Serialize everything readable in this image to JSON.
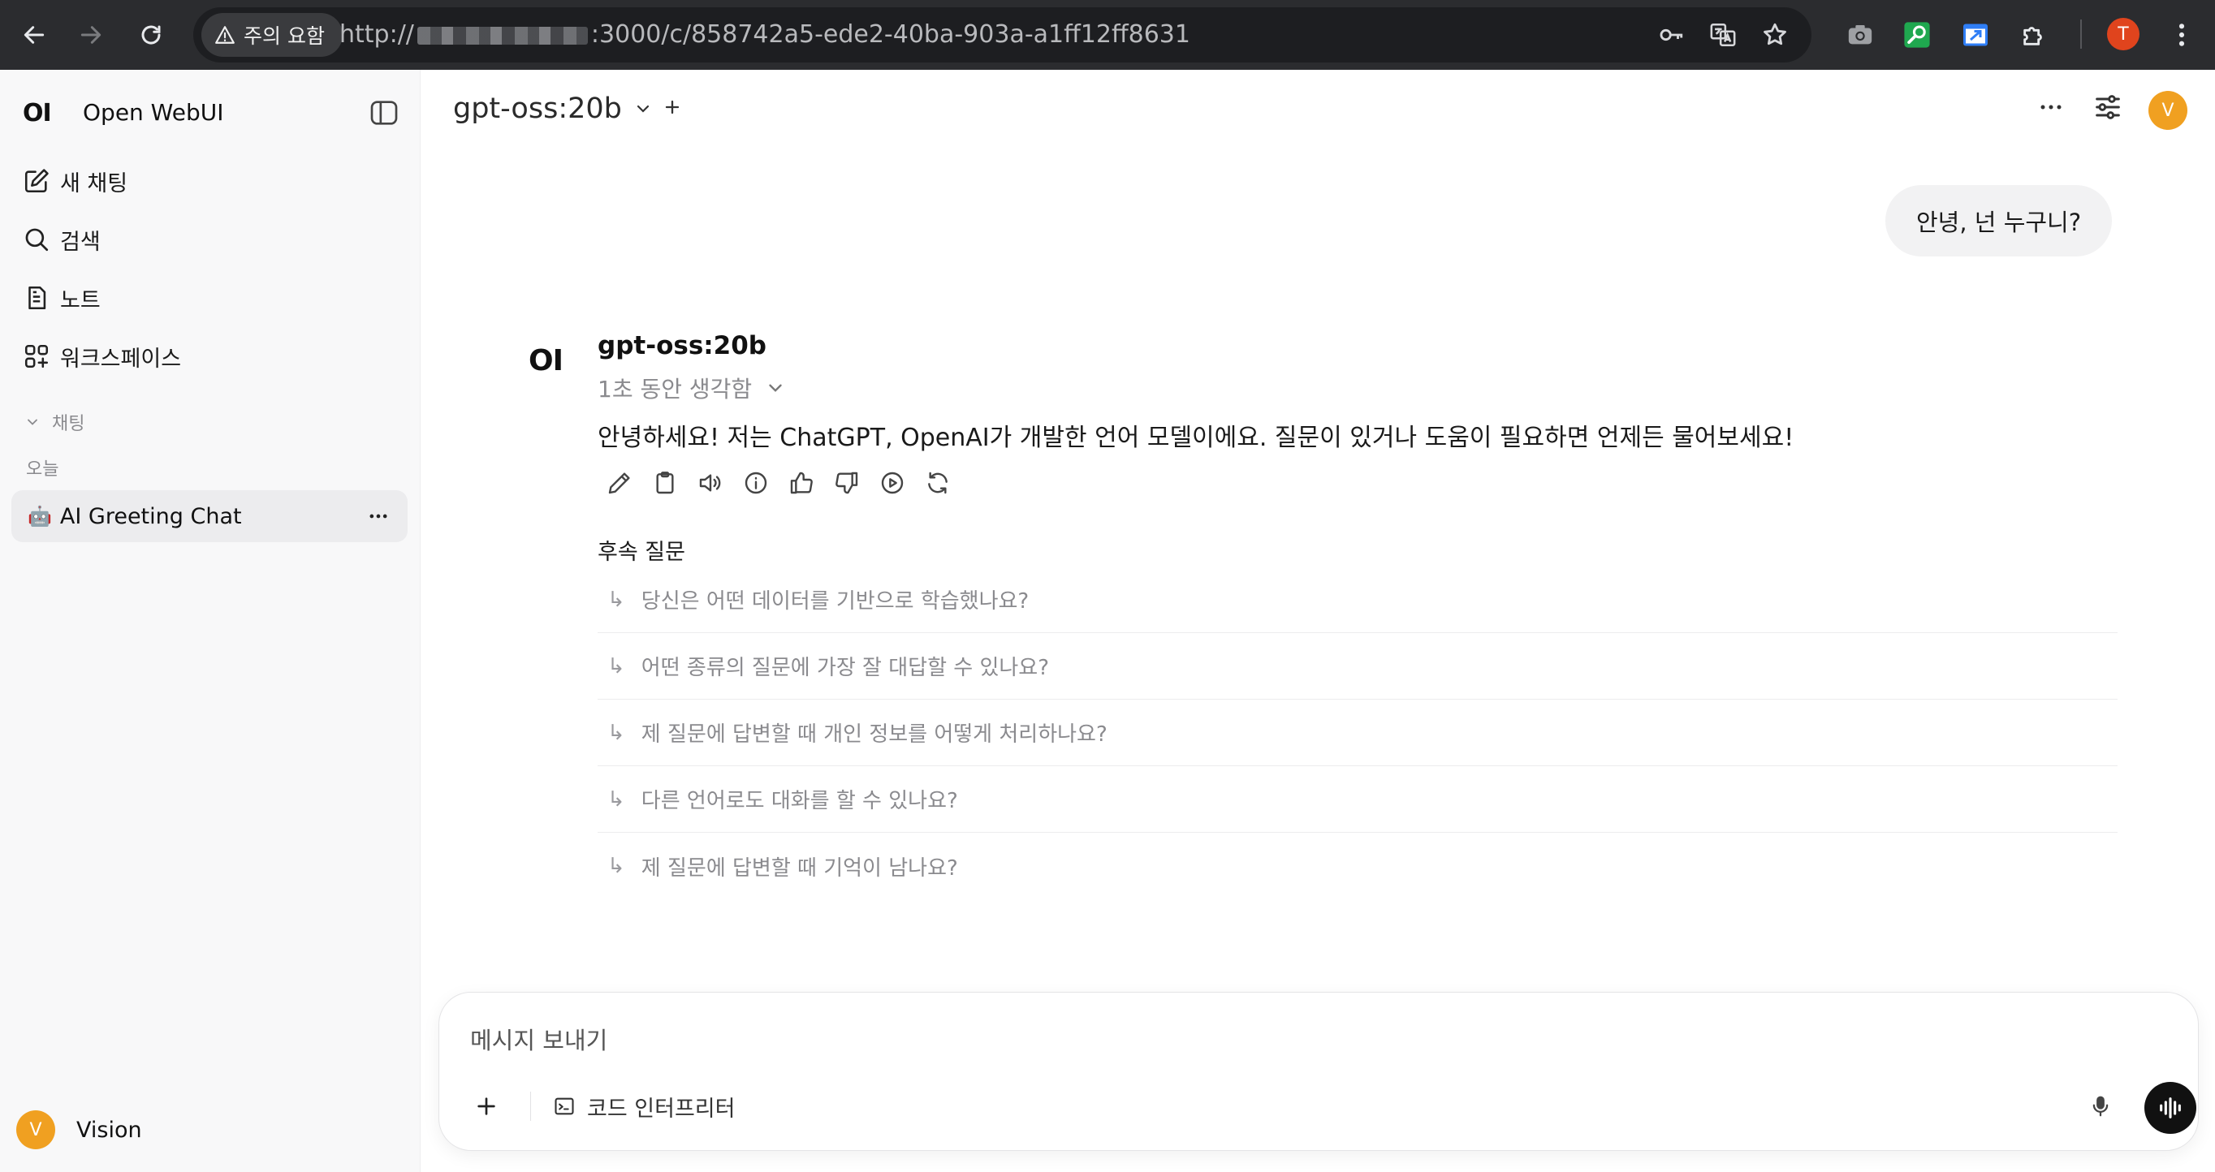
{
  "browser": {
    "security_label": "주의 요함",
    "url_prefix": "http://",
    "url_suffix": ":3000/c/858742a5-ede2-40ba-903a-a1ff12ff8631",
    "profile_initial": "T"
  },
  "sidebar": {
    "logo": "OI",
    "app_name": "Open WebUI",
    "items": [
      {
        "label": "새 채팅",
        "icon": "edit-icon"
      },
      {
        "label": "검색",
        "icon": "search-icon"
      },
      {
        "label": "노트",
        "icon": "note-icon"
      },
      {
        "label": "워크스페이스",
        "icon": "workspace-icon"
      }
    ],
    "section_label": "채팅",
    "date_group": "오늘",
    "chats": [
      {
        "emoji": "🤖",
        "title": "AI Greeting Chat"
      }
    ],
    "user": {
      "initial": "V",
      "name": "Vision"
    }
  },
  "header": {
    "model_name": "gpt-oss:20b",
    "avatar_initial": "V"
  },
  "conversation": {
    "user_message": "안녕, 넌 누구니?",
    "bot_logo": "OI",
    "bot_name": "gpt-oss:20b",
    "thinking_label": "1초 동안 생각함",
    "bot_message": "안녕하세요! 저는 ChatGPT, OpenAI가 개발한 언어 모델이에요. 질문이 있거나 도움이 필요하면 언제든 물어보세요!",
    "followup_title": "후속 질문",
    "followups": [
      "당신은 어떤 데이터를 기반으로 학습했나요?",
      "어떤 종류의 질문에 가장 잘 대답할 수 있나요?",
      "제 질문에 답변할 때 개인 정보를 어떻게 처리하나요?",
      "다른 언어로도 대화를 할 수 있나요?",
      "제 질문에 답변할 때 기억이 남나요?"
    ],
    "followup_arrow": "↳"
  },
  "composer": {
    "placeholder": "메시지 보내기",
    "tool_label": "코드 인터프리터"
  },
  "colors": {
    "accent_avatar": "#f0a021",
    "chrome_bg": "#2b2c2f",
    "sidebar_bg": "#f8f8f9"
  }
}
